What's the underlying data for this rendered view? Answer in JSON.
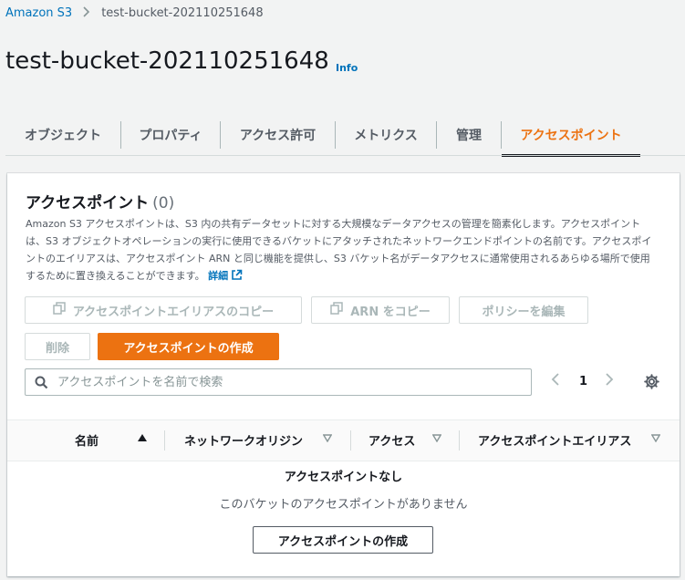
{
  "breadcrumb": {
    "root": "Amazon S3",
    "current": "test-bucket-202110251648"
  },
  "page": {
    "title": "test-bucket-202110251648",
    "info": "Info"
  },
  "tabs": [
    {
      "label": "オブジェクト"
    },
    {
      "label": "プロパティ"
    },
    {
      "label": "アクセス許可"
    },
    {
      "label": "メトリクス"
    },
    {
      "label": "管理"
    },
    {
      "label": "アクセスポイント",
      "active": true
    }
  ],
  "panel": {
    "title": "アクセスポイント",
    "count": "(0)",
    "description": "Amazon S3 アクセスポイントは、S3 内の共有データセットに対する大規模なデータアクセスの管理を簡素化します。アクセスポイントは、S3 オブジェクトオペレーションの実行に使用できるバケットにアタッチされたネットワークエンドポイントの名前です。アクセスポイントのエイリアスは、アクセスポイント ARN と同じ機能を提供し、S3 バケット名がデータアクセスに通常使用されるあらゆる場所で使用するために置き換えることができます。",
    "more_link": "詳細",
    "buttons": {
      "copy_alias": "アクセスポイントエイリアスのコピー",
      "copy_arn": "ARN をコピー",
      "edit_policy": "ポリシーを編集",
      "delete": "削除",
      "create": "アクセスポイントの作成"
    },
    "search": {
      "placeholder": "アクセスポイントを名前で検索"
    },
    "pagination": {
      "current_page": "1"
    },
    "columns": [
      "名前",
      "ネットワークオリジン",
      "アクセス",
      "アクセスポイントエイリアス"
    ],
    "empty": {
      "title": "アクセスポイントなし",
      "description": "このバケットのアクセスポイントがありません",
      "button": "アクセスポイントの作成"
    }
  },
  "colors": {
    "accent": "#ec7211",
    "link": "#0073bb",
    "text": "#16191f",
    "muted": "#545b64",
    "disabled": "#aab7b8"
  }
}
